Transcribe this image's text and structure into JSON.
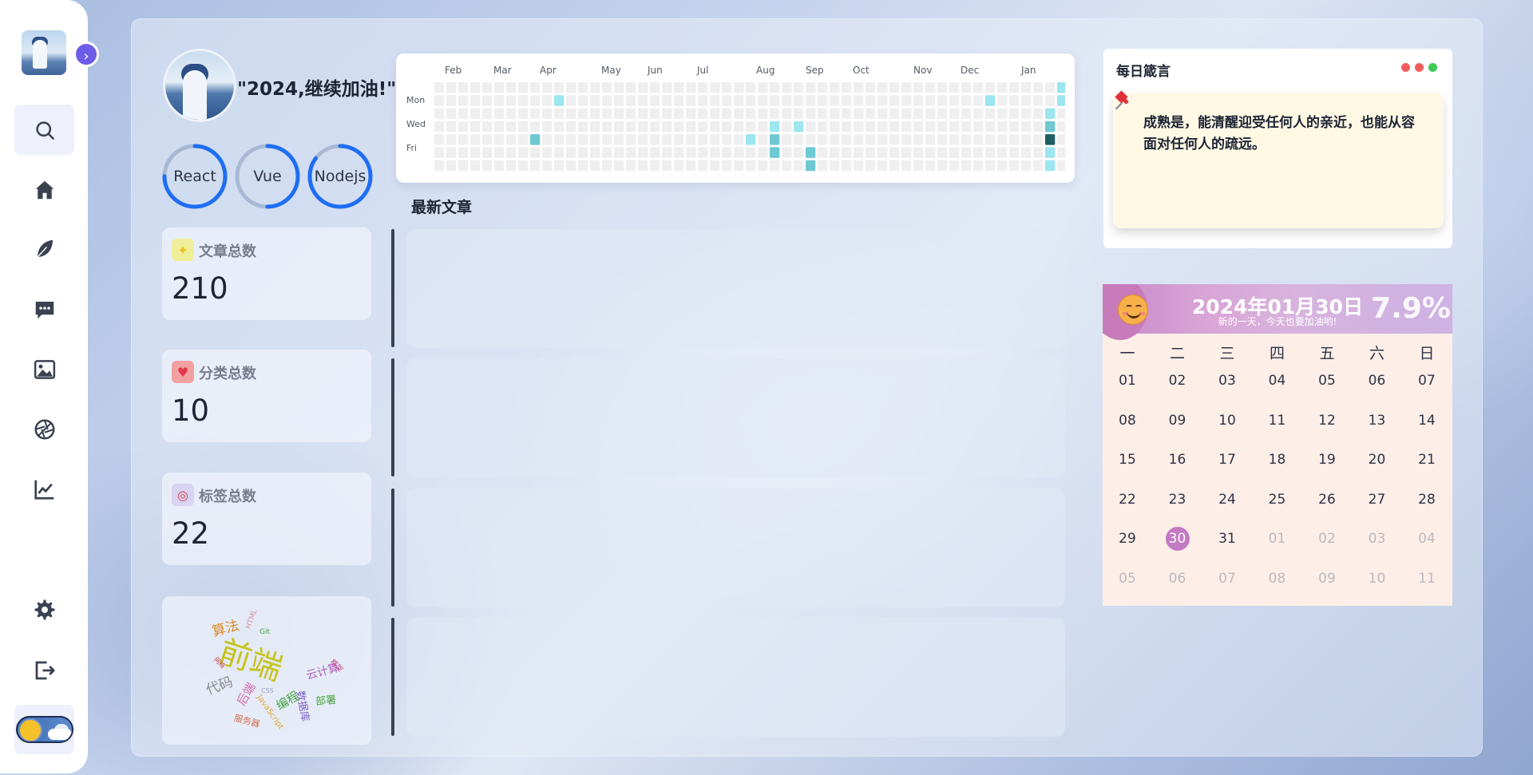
{
  "sidebar": {
    "expand_icon": "chevron-right-icon",
    "items": [
      {
        "name": "search",
        "icon": "search-icon",
        "active": true
      },
      {
        "name": "home",
        "icon": "home-icon"
      },
      {
        "name": "write",
        "icon": "feather-icon"
      },
      {
        "name": "comments",
        "icon": "chat-icon"
      },
      {
        "name": "gallery",
        "icon": "image-icon"
      },
      {
        "name": "aperture",
        "icon": "aperture-icon"
      },
      {
        "name": "stats",
        "icon": "line-chart-icon"
      },
      {
        "name": "settings",
        "icon": "gear-icon"
      },
      {
        "name": "logout",
        "icon": "logout-icon"
      }
    ],
    "theme_toggle": "day"
  },
  "profile": {
    "motto": "\"2024,继续加油!\"",
    "skills": [
      {
        "label": "React",
        "progress": 0.75
      },
      {
        "label": "Vue",
        "progress": 0.5
      },
      {
        "label": "Nodejs",
        "progress": 0.85
      }
    ]
  },
  "stats": [
    {
      "label": "文章总数",
      "value": "210",
      "icon": "sparkle-icon",
      "color": "#f1ee9a"
    },
    {
      "label": "分类总数",
      "value": "10",
      "icon": "heart-icon",
      "color": "#f3a0a0"
    },
    {
      "label": "标签总数",
      "value": "22",
      "icon": "target-icon",
      "color": "#d8d4f2"
    }
  ],
  "wordcloud": {
    "words": [
      {
        "text": "前端",
        "color": "#c6c31c"
      },
      {
        "text": "算法",
        "color": "#e08a1e"
      },
      {
        "text": "代码",
        "color": "#888888"
      },
      {
        "text": "后端",
        "color": "#d36bb0"
      },
      {
        "text": "编程",
        "color": "#4aa341"
      },
      {
        "text": "云计算",
        "color": "#b060c0"
      },
      {
        "text": "数据库",
        "color": "#7e5fc2"
      },
      {
        "text": "部署",
        "color": "#4aa341"
      },
      {
        "text": "服务器",
        "color": "#d86b4a"
      },
      {
        "text": "JavaScript",
        "color": "#e0a83a"
      },
      {
        "text": "HTML",
        "color": "#d88fa0"
      },
      {
        "text": "Git",
        "color": "#4aa341"
      },
      {
        "text": "CSS",
        "color": "#a0a0c8"
      },
      {
        "text": "框架",
        "color": "#c84a8a"
      },
      {
        "text": "网络",
        "color": "#c84a4a"
      }
    ]
  },
  "heatmap": {
    "months": [
      "Feb",
      "Mar",
      "Apr",
      "May",
      "Jun",
      "Jul",
      "Aug",
      "Sep",
      "Oct",
      "Nov",
      "Dec",
      "Jan"
    ],
    "day_labels": [
      "Mon",
      "Wed",
      "Fri"
    ],
    "colors": {
      "empty": "#efefef",
      "l1": "#9be6ef",
      "l2": "#6ec9d3",
      "l3": "#3e9fab",
      "l4": "#1f5e63"
    },
    "cells": [
      {
        "week": 10,
        "day": 1,
        "level": 1
      },
      {
        "week": 8,
        "day": 4,
        "level": 2
      },
      {
        "week": 26,
        "day": 4,
        "level": 1
      },
      {
        "week": 28,
        "day": 3,
        "level": 1
      },
      {
        "week": 28,
        "day": 4,
        "level": 2
      },
      {
        "week": 28,
        "day": 5,
        "level": 2
      },
      {
        "week": 30,
        "day": 3,
        "level": 1
      },
      {
        "week": 31,
        "day": 5,
        "level": 2
      },
      {
        "week": 31,
        "day": 6,
        "level": 2
      },
      {
        "week": 46,
        "day": 1,
        "level": 1
      },
      {
        "week": 51,
        "day": 2,
        "level": 1
      },
      {
        "week": 51,
        "day": 3,
        "level": 2
      },
      {
        "week": 51,
        "day": 4,
        "level": 4
      },
      {
        "week": 51,
        "day": 5,
        "level": 1
      },
      {
        "week": 51,
        "day": 6,
        "level": 1
      },
      {
        "week": 52,
        "day": 0,
        "level": 1
      },
      {
        "week": 52,
        "day": 1,
        "level": 1
      }
    ]
  },
  "posts": {
    "title": "最新文章",
    "items": [
      {},
      {},
      {},
      {}
    ]
  },
  "quote": {
    "title": "每日箴言",
    "text": "成熟是，能清醒迎受任何人的亲近，也能从容面对任何人的疏远。",
    "dots": [
      "#f05d5d",
      "#f05d5d",
      "#3ecb55"
    ]
  },
  "calendar": {
    "date": "2024年01月30日",
    "subtitle": "新的一天，今天也要加油哟!",
    "percent": "7.9%",
    "weekdays": [
      "一",
      "二",
      "三",
      "四",
      "五",
      "六",
      "日"
    ],
    "rows": [
      [
        "01",
        "02",
        "03",
        "04",
        "05",
        "06",
        "07"
      ],
      [
        "08",
        "09",
        "10",
        "11",
        "12",
        "13",
        "14"
      ],
      [
        "15",
        "16",
        "17",
        "18",
        "19",
        "20",
        "21"
      ],
      [
        "22",
        "23",
        "24",
        "25",
        "26",
        "27",
        "28"
      ],
      [
        "29",
        "30",
        "31",
        "01",
        "02",
        "03",
        "04"
      ],
      [
        "05",
        "06",
        "07",
        "08",
        "09",
        "10",
        "11"
      ]
    ],
    "today": "30",
    "other_month_from": {
      "row": 4,
      "col": 3
    }
  }
}
